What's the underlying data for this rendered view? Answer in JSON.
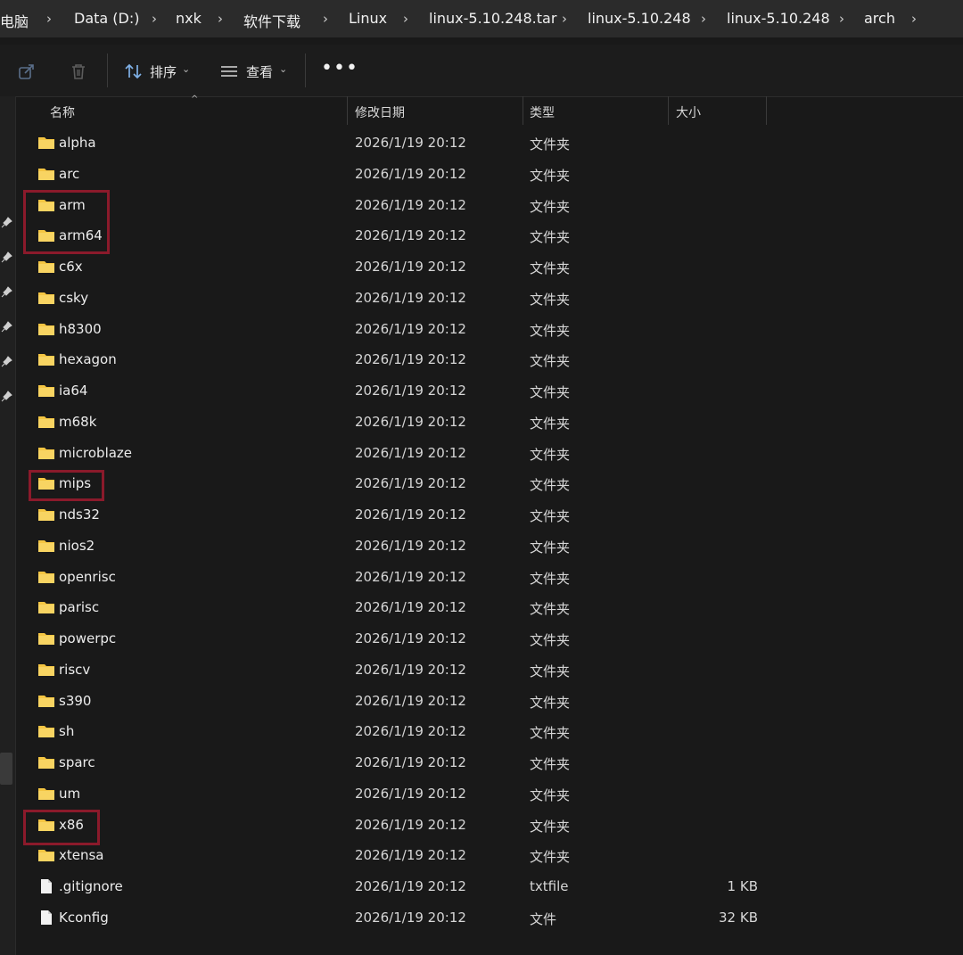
{
  "breadcrumb": [
    "电脑",
    "Data (D:)",
    "nxk",
    "软件下载",
    "Linux",
    "linux-5.10.248.tar",
    "linux-5.10.248",
    "linux-5.10.248",
    "arch"
  ],
  "toolbar": {
    "sort_label": "排序",
    "view_label": "查看",
    "more_label": "•••"
  },
  "columns": {
    "name": "名称",
    "date": "修改日期",
    "type": "类型",
    "size": "大小"
  },
  "files": [
    {
      "name": "alpha",
      "date": "2026/1/19 20:12",
      "type": "文件夹",
      "size": "",
      "kind": "folder"
    },
    {
      "name": "arc",
      "date": "2026/1/19 20:12",
      "type": "文件夹",
      "size": "",
      "kind": "folder"
    },
    {
      "name": "arm",
      "date": "2026/1/19 20:12",
      "type": "文件夹",
      "size": "",
      "kind": "folder"
    },
    {
      "name": "arm64",
      "date": "2026/1/19 20:12",
      "type": "文件夹",
      "size": "",
      "kind": "folder"
    },
    {
      "name": "c6x",
      "date": "2026/1/19 20:12",
      "type": "文件夹",
      "size": "",
      "kind": "folder"
    },
    {
      "name": "csky",
      "date": "2026/1/19 20:12",
      "type": "文件夹",
      "size": "",
      "kind": "folder"
    },
    {
      "name": "h8300",
      "date": "2026/1/19 20:12",
      "type": "文件夹",
      "size": "",
      "kind": "folder"
    },
    {
      "name": "hexagon",
      "date": "2026/1/19 20:12",
      "type": "文件夹",
      "size": "",
      "kind": "folder"
    },
    {
      "name": "ia64",
      "date": "2026/1/19 20:12",
      "type": "文件夹",
      "size": "",
      "kind": "folder"
    },
    {
      "name": "m68k",
      "date": "2026/1/19 20:12",
      "type": "文件夹",
      "size": "",
      "kind": "folder"
    },
    {
      "name": "microblaze",
      "date": "2026/1/19 20:12",
      "type": "文件夹",
      "size": "",
      "kind": "folder"
    },
    {
      "name": "mips",
      "date": "2026/1/19 20:12",
      "type": "文件夹",
      "size": "",
      "kind": "folder"
    },
    {
      "name": "nds32",
      "date": "2026/1/19 20:12",
      "type": "文件夹",
      "size": "",
      "kind": "folder"
    },
    {
      "name": "nios2",
      "date": "2026/1/19 20:12",
      "type": "文件夹",
      "size": "",
      "kind": "folder"
    },
    {
      "name": "openrisc",
      "date": "2026/1/19 20:12",
      "type": "文件夹",
      "size": "",
      "kind": "folder"
    },
    {
      "name": "parisc",
      "date": "2026/1/19 20:12",
      "type": "文件夹",
      "size": "",
      "kind": "folder"
    },
    {
      "name": "powerpc",
      "date": "2026/1/19 20:12",
      "type": "文件夹",
      "size": "",
      "kind": "folder"
    },
    {
      "name": "riscv",
      "date": "2026/1/19 20:12",
      "type": "文件夹",
      "size": "",
      "kind": "folder"
    },
    {
      "name": "s390",
      "date": "2026/1/19 20:12",
      "type": "文件夹",
      "size": "",
      "kind": "folder"
    },
    {
      "name": "sh",
      "date": "2026/1/19 20:12",
      "type": "文件夹",
      "size": "",
      "kind": "folder"
    },
    {
      "name": "sparc",
      "date": "2026/1/19 20:12",
      "type": "文件夹",
      "size": "",
      "kind": "folder"
    },
    {
      "name": "um",
      "date": "2026/1/19 20:12",
      "type": "文件夹",
      "size": "",
      "kind": "folder"
    },
    {
      "name": "x86",
      "date": "2026/1/19 20:12",
      "type": "文件夹",
      "size": "",
      "kind": "folder"
    },
    {
      "name": "xtensa",
      "date": "2026/1/19 20:12",
      "type": "文件夹",
      "size": "",
      "kind": "folder"
    },
    {
      "name": ".gitignore",
      "date": "2026/1/19 20:12",
      "type": "txtfile",
      "size": "1 KB",
      "kind": "file"
    },
    {
      "name": "Kconfig",
      "date": "2026/1/19 20:12",
      "type": "文件",
      "size": "32 KB",
      "kind": "file"
    }
  ],
  "colors": {
    "folder": "#f4c542",
    "highlight": "#8b1a2b",
    "background": "#191919"
  }
}
